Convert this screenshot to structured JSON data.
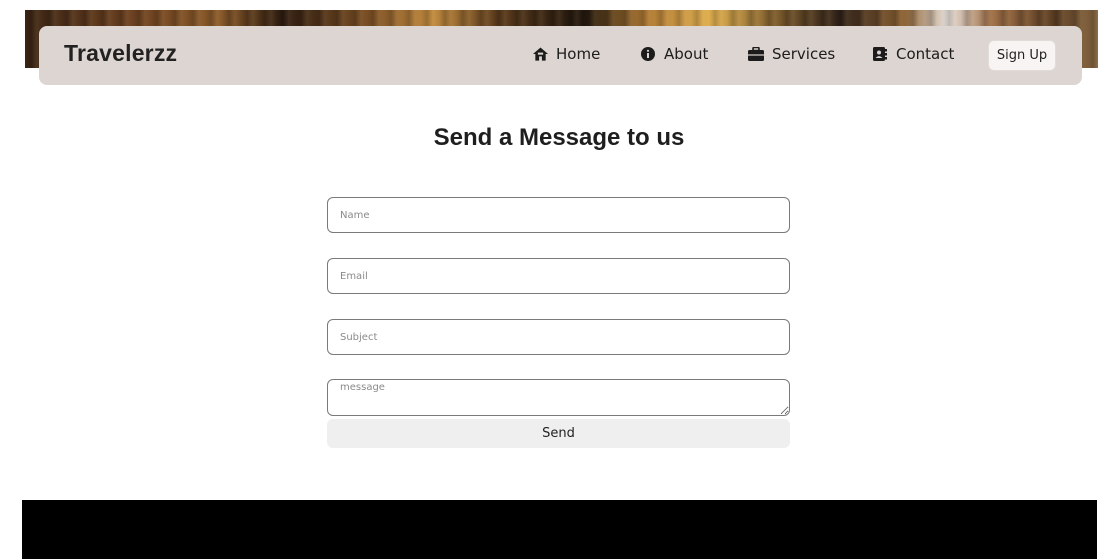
{
  "brand": {
    "name": "Travelerzz"
  },
  "nav": {
    "items": [
      {
        "label": "Home",
        "icon": "home-icon"
      },
      {
        "label": "About",
        "icon": "info-circle-icon"
      },
      {
        "label": "Services",
        "icon": "briefcase-icon"
      },
      {
        "label": "Contact",
        "icon": "address-book-icon"
      }
    ],
    "signup_label": "Sign Up"
  },
  "contact": {
    "title": "Send a Message to us",
    "name_placeholder": "Name",
    "email_placeholder": "Email",
    "subject_placeholder": "Subject",
    "message_placeholder": "message",
    "send_label": "Send"
  },
  "colors": {
    "navbar_bg": "#dcd5d2",
    "footer_bg": "#000000",
    "button_bg": "#efefef"
  }
}
